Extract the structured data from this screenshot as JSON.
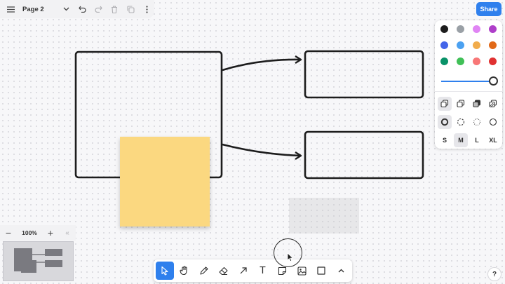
{
  "top_menu": {
    "page_name": "Page 2",
    "icons": [
      "hamburger-menu-icon",
      "chevron-down-icon",
      "undo-icon",
      "redo-icon",
      "trash-icon",
      "duplicate-icon",
      "more-vertical-icon"
    ]
  },
  "share_label": "Share",
  "style_panel": {
    "colors": [
      "#1d1d1d",
      "#9aa0a6",
      "#e085f4",
      "#ae3ec9",
      "#4465e9",
      "#4ba1f1",
      "#f1ac4b",
      "#e16919",
      "#099268",
      "#40c057",
      "#f87777",
      "#e03131"
    ],
    "opacity": 1.0,
    "accent": "#2f80ed",
    "fill_options": [
      "fill-none",
      "fill-semi",
      "fill-solid",
      "fill-pattern"
    ],
    "dash_options": [
      "dash-draw",
      "dash-dashed",
      "dash-dotted",
      "dash-solid"
    ],
    "sizes": [
      "S",
      "M",
      "L",
      "XL"
    ],
    "selected_size": "M"
  },
  "zoom": {
    "minus": "−",
    "level": "100%",
    "plus": "+",
    "collapse": "«"
  },
  "toolbar": {
    "tools": [
      "select-tool",
      "hand-tool",
      "draw-tool",
      "eraser-tool",
      "arrow-tool",
      "text-tool",
      "note-tool",
      "image-tool",
      "rectangle-tool",
      "more-tools"
    ],
    "text_glyph": "T",
    "active": "select-tool"
  },
  "help_label": "?"
}
